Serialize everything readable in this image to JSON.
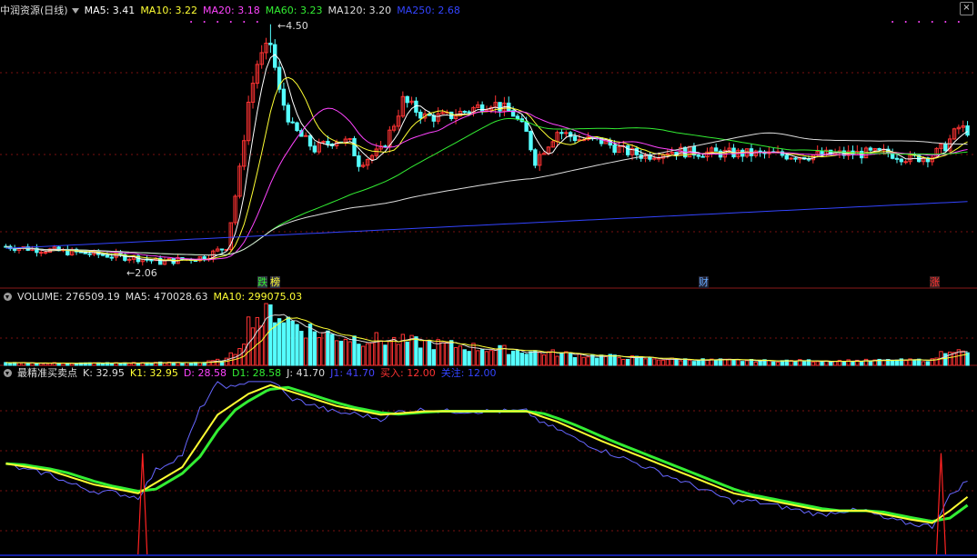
{
  "price_panel": {
    "title": "中润资源(日线)",
    "legend": [
      {
        "label": "MA5: 3.41",
        "color": "#ffffff"
      },
      {
        "label": "MA10: 3.22",
        "color": "#ffff33"
      },
      {
        "label": "MA20: 3.18",
        "color": "#ff44ff"
      },
      {
        "label": "MA60: 3.23",
        "color": "#33ee33"
      },
      {
        "label": "MA120: 3.20",
        "color": "#dddddd"
      },
      {
        "label": "MA250: 2.68",
        "color": "#3344ff"
      }
    ],
    "high_label": "4.50",
    "low_label": "2.06",
    "markers": [
      {
        "text": "跌",
        "color": "#33ee33"
      },
      {
        "text": "榜",
        "color": "#ffff33"
      },
      {
        "text": "财",
        "color": "#66aaff"
      },
      {
        "text": "涨",
        "color": "#ff3333"
      }
    ],
    "close_icon": "×"
  },
  "volume_panel": {
    "legend": [
      {
        "label": "VOLUME: 276509.19",
        "color": "#dddddd"
      },
      {
        "label": "MA5: 470028.63",
        "color": "#dddddd"
      },
      {
        "label": "MA10: 299075.03",
        "color": "#ffff33"
      }
    ]
  },
  "indicator_panel": {
    "legend": [
      {
        "label": "最精准买卖点",
        "color": "#dddddd"
      },
      {
        "label": "K: 32.95",
        "color": "#dddddd"
      },
      {
        "label": "K1: 32.95",
        "color": "#ffff33"
      },
      {
        "label": "D: 28.58",
        "color": "#ff44ff"
      },
      {
        "label": "D1: 28.58",
        "color": "#33ee33"
      },
      {
        "label": "J: 41.70",
        "color": "#dddddd"
      },
      {
        "label": "J1: 41.70",
        "color": "#4444ff"
      },
      {
        "label": "买入: 12.00",
        "color": "#ff3333"
      },
      {
        "label": "关注: 12.00",
        "color": "#3344ff"
      }
    ]
  },
  "colors": {
    "up": "#ff3333",
    "down": "#55ffff",
    "ma5": "#ffffff",
    "ma10": "#ffff33",
    "ma20": "#ff44ff",
    "ma60": "#33ee33",
    "ma120": "#dddddd",
    "ma250": "#3344ff",
    "grid": "#7a1010"
  },
  "chart_data": [
    {
      "type": "candlestick",
      "title": "中润资源(日线)",
      "ylim": [
        1.95,
        4.6
      ],
      "price_anchors": [
        [
          0,
          2.22
        ],
        [
          20,
          2.14
        ],
        [
          30,
          2.1
        ],
        [
          35,
          2.06
        ],
        [
          45,
          2.11
        ],
        [
          50,
          2.22
        ],
        [
          53,
          3.0
        ],
        [
          55,
          3.7
        ],
        [
          57,
          4.1
        ],
        [
          60,
          4.3
        ],
        [
          62,
          3.8
        ],
        [
          65,
          3.43
        ],
        [
          70,
          3.22
        ],
        [
          75,
          3.32
        ],
        [
          78,
          3.28
        ],
        [
          80,
          3.08
        ],
        [
          85,
          3.2
        ],
        [
          88,
          3.48
        ],
        [
          90,
          3.72
        ],
        [
          95,
          3.55
        ],
        [
          100,
          3.55
        ],
        [
          105,
          3.62
        ],
        [
          110,
          3.7
        ],
        [
          115,
          3.58
        ],
        [
          118,
          3.38
        ],
        [
          120,
          3.1
        ],
        [
          125,
          3.4
        ],
        [
          130,
          3.32
        ],
        [
          135,
          3.3
        ],
        [
          140,
          3.2
        ],
        [
          145,
          3.15
        ],
        [
          150,
          3.2
        ],
        [
          160,
          3.18
        ],
        [
          170,
          3.17
        ],
        [
          180,
          3.15
        ],
        [
          190,
          3.17
        ],
        [
          200,
          3.18
        ],
        [
          205,
          3.12
        ],
        [
          210,
          3.15
        ],
        [
          213,
          3.25
        ],
        [
          216,
          3.44
        ],
        [
          218,
          3.41
        ]
      ],
      "highs": [
        {
          "index": 60,
          "value": 4.5
        }
      ],
      "lows": [
        {
          "index": 35,
          "value": 2.06
        }
      ],
      "series": [
        {
          "name": "MA5",
          "last": 3.41
        },
        {
          "name": "MA10",
          "last": 3.22
        },
        {
          "name": "MA20",
          "last": 3.18
        },
        {
          "name": "MA60",
          "last": 3.23
        },
        {
          "name": "MA120",
          "last": 3.2
        },
        {
          "name": "MA250",
          "last": 2.68
        }
      ],
      "bars": 219
    },
    {
      "type": "bar",
      "title": "VOLUME",
      "last_volume": 276509.19,
      "ma5": 470028.63,
      "ma10": 299075.03,
      "vol_anchors": [
        [
          0,
          0.03
        ],
        [
          25,
          0.03
        ],
        [
          45,
          0.04
        ],
        [
          50,
          0.08
        ],
        [
          52,
          0.18
        ],
        [
          54,
          0.4
        ],
        [
          56,
          0.7
        ],
        [
          58,
          0.6
        ],
        [
          61,
          0.75
        ],
        [
          64,
          0.6
        ],
        [
          70,
          0.45
        ],
        [
          76,
          0.38
        ],
        [
          82,
          0.35
        ],
        [
          90,
          0.32
        ],
        [
          100,
          0.27
        ],
        [
          110,
          0.22
        ],
        [
          120,
          0.18
        ],
        [
          135,
          0.12
        ],
        [
          150,
          0.08
        ],
        [
          170,
          0.06
        ],
        [
          190,
          0.06
        ],
        [
          210,
          0.07
        ],
        [
          214,
          0.25
        ],
        [
          216,
          0.18
        ],
        [
          218,
          0.15
        ]
      ]
    },
    {
      "type": "line",
      "title": "最精准买卖点",
      "ylim": [
        0,
        100
      ],
      "series": [
        {
          "name": "K1",
          "last": 32.95
        },
        {
          "name": "D1",
          "last": 28.58
        },
        {
          "name": "J1",
          "last": 41.7
        },
        {
          "name": "买入",
          "last": 12.0
        },
        {
          "name": "关注",
          "last": 12.0
        }
      ],
      "k_anchors": [
        [
          0,
          52
        ],
        [
          10,
          48
        ],
        [
          20,
          40
        ],
        [
          30,
          35
        ],
        [
          40,
          50
        ],
        [
          48,
          80
        ],
        [
          55,
          92
        ],
        [
          60,
          97
        ],
        [
          65,
          93
        ],
        [
          75,
          85
        ],
        [
          85,
          80
        ],
        [
          95,
          82
        ],
        [
          105,
          82
        ],
        [
          118,
          82
        ],
        [
          125,
          76
        ],
        [
          135,
          65
        ],
        [
          145,
          55
        ],
        [
          155,
          45
        ],
        [
          165,
          35
        ],
        [
          175,
          30
        ],
        [
          185,
          25
        ],
        [
          195,
          25
        ],
        [
          205,
          20
        ],
        [
          210,
          18
        ],
        [
          214,
          25
        ],
        [
          218,
          32.95
        ]
      ],
      "buy_signals": [
        31,
        212
      ]
    }
  ]
}
